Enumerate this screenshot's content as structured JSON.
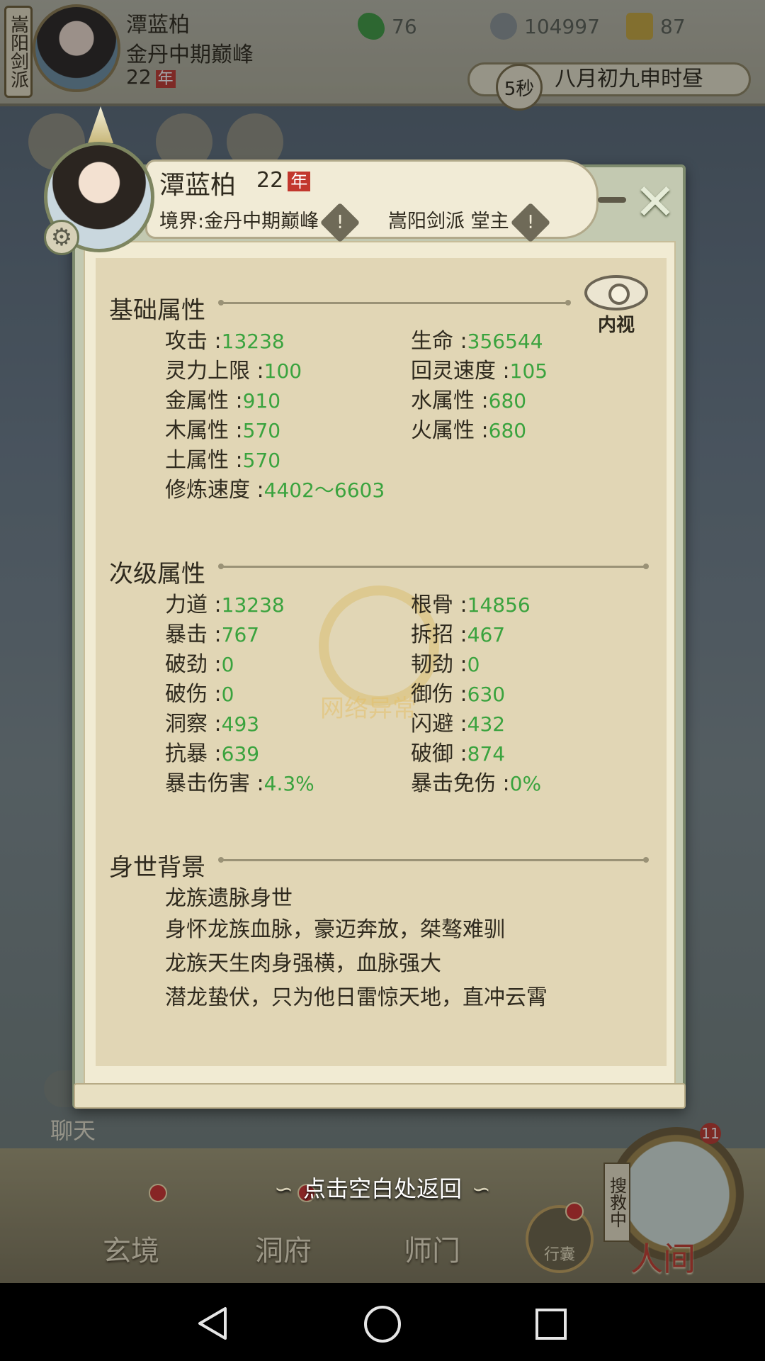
{
  "background": {
    "sect_tag": "嵩阳剑派",
    "header": {
      "name": "潭蓝柏",
      "realm": "金丹中期巅峰",
      "age": "22",
      "age_unit": "年"
    },
    "resources": [
      {
        "icon": "jade-leaf-icon",
        "value": "76",
        "color": "#3f9a3e"
      },
      {
        "icon": "coin-icon",
        "value": "104997",
        "color": "#8d9493"
      },
      {
        "icon": "trophy-icon",
        "value": "87",
        "color": "#c9a63a"
      }
    ],
    "timer": {
      "seconds": "5秒",
      "date": "八月初九申时昼"
    },
    "chat_label": "聊天",
    "bottom_nav": [
      "玄境",
      "洞府",
      "师门",
      "行囊",
      "人间"
    ],
    "search_tag": "搜救中",
    "badge_count": "11"
  },
  "panel": {
    "name": "潭蓝柏",
    "age": "22",
    "age_unit": "年",
    "realm_line": "境界:金丹中期巅峰",
    "sect_line": "嵩阳剑派 堂主",
    "inner_view_label": "内视",
    "sections": {
      "basic": {
        "title": "基础属性",
        "left": [
          {
            "label": "攻击 :",
            "value": "13238"
          },
          {
            "label": "灵力上限 :",
            "value": "100"
          },
          {
            "label": "金属性 :",
            "value": "910"
          },
          {
            "label": "木属性 :",
            "value": "570"
          },
          {
            "label": "土属性 :",
            "value": "570"
          },
          {
            "label": "修炼速度 :",
            "value": "4402～6603"
          }
        ],
        "right": [
          {
            "label": "生命 :",
            "value": "356544"
          },
          {
            "label": "回灵速度 :",
            "value": "105"
          },
          {
            "label": "水属性 :",
            "value": "680"
          },
          {
            "label": "火属性 :",
            "value": "680"
          }
        ]
      },
      "secondary": {
        "title": "次级属性",
        "left": [
          {
            "label": "力道 :",
            "value": "13238"
          },
          {
            "label": "暴击 :",
            "value": "767"
          },
          {
            "label": "破劲 :",
            "value": "0"
          },
          {
            "label": "破伤 :",
            "value": "0"
          },
          {
            "label": "洞察 :",
            "value": "493"
          },
          {
            "label": "抗暴 :",
            "value": "639"
          },
          {
            "label": "暴击伤害 :",
            "value": "4.3%"
          }
        ],
        "right": [
          {
            "label": "根骨 :",
            "value": "14856"
          },
          {
            "label": "拆招 :",
            "value": "467"
          },
          {
            "label": "韧劲 :",
            "value": "0"
          },
          {
            "label": "御伤 :",
            "value": "630"
          },
          {
            "label": "闪避 :",
            "value": "432"
          },
          {
            "label": "破御 :",
            "value": "874"
          },
          {
            "label": "暴击免伤 :",
            "value": "0%"
          }
        ]
      },
      "background": {
        "title": "身世背景",
        "lines": [
          "龙族遗脉身世",
          "身怀龙族血脉，豪迈奔放，桀骜难驯",
          "龙族天生肉身强横，血脉强大",
          "潜龙蛰伏，只为他日雷惊天地，直冲云霄"
        ]
      }
    },
    "watermark": "网络异常"
  },
  "return_hint": "点击空白处返回",
  "system_nav": {
    "back_icon": "back-triangle-icon",
    "home_icon": "home-circle-icon",
    "recent_icon": "recent-square-icon"
  }
}
